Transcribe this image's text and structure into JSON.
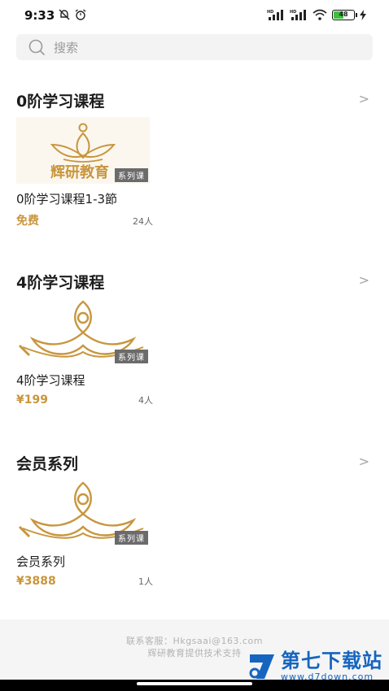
{
  "status_bar": {
    "time": "9:33",
    "battery": "48",
    "left_icons": [
      "notifications-off-icon",
      "alarm-icon"
    ],
    "right_icons": [
      "hd-signal-icon",
      "hd-signal-icon",
      "wifi-icon",
      "battery-icon",
      "charging-icon"
    ]
  },
  "search": {
    "placeholder": "搜索"
  },
  "sections": [
    {
      "title": "0阶学习课程",
      "course": {
        "name": "0阶学习课程1-3節",
        "price": "免费",
        "count": "24人",
        "tag": "系列课",
        "logo_text": "辉研教育"
      }
    },
    {
      "title": "4阶学习课程",
      "course": {
        "name": "4阶学习课程",
        "price": "¥199",
        "count": "4人",
        "tag": "系列课"
      }
    },
    {
      "title": "会员系列",
      "course": {
        "name": "会员系列",
        "price": "¥3888",
        "count": "1人",
        "tag": "系列课"
      }
    }
  ],
  "footer": {
    "contact": "联系客服：Hkgsaai@163.com",
    "support": "辉研教育提供技术支持"
  },
  "watermark": {
    "title": "第七下载站",
    "url": "www.d7down.com"
  },
  "colors": {
    "accent_gold": "#c8963e",
    "watermark_blue": "#1565c0"
  }
}
